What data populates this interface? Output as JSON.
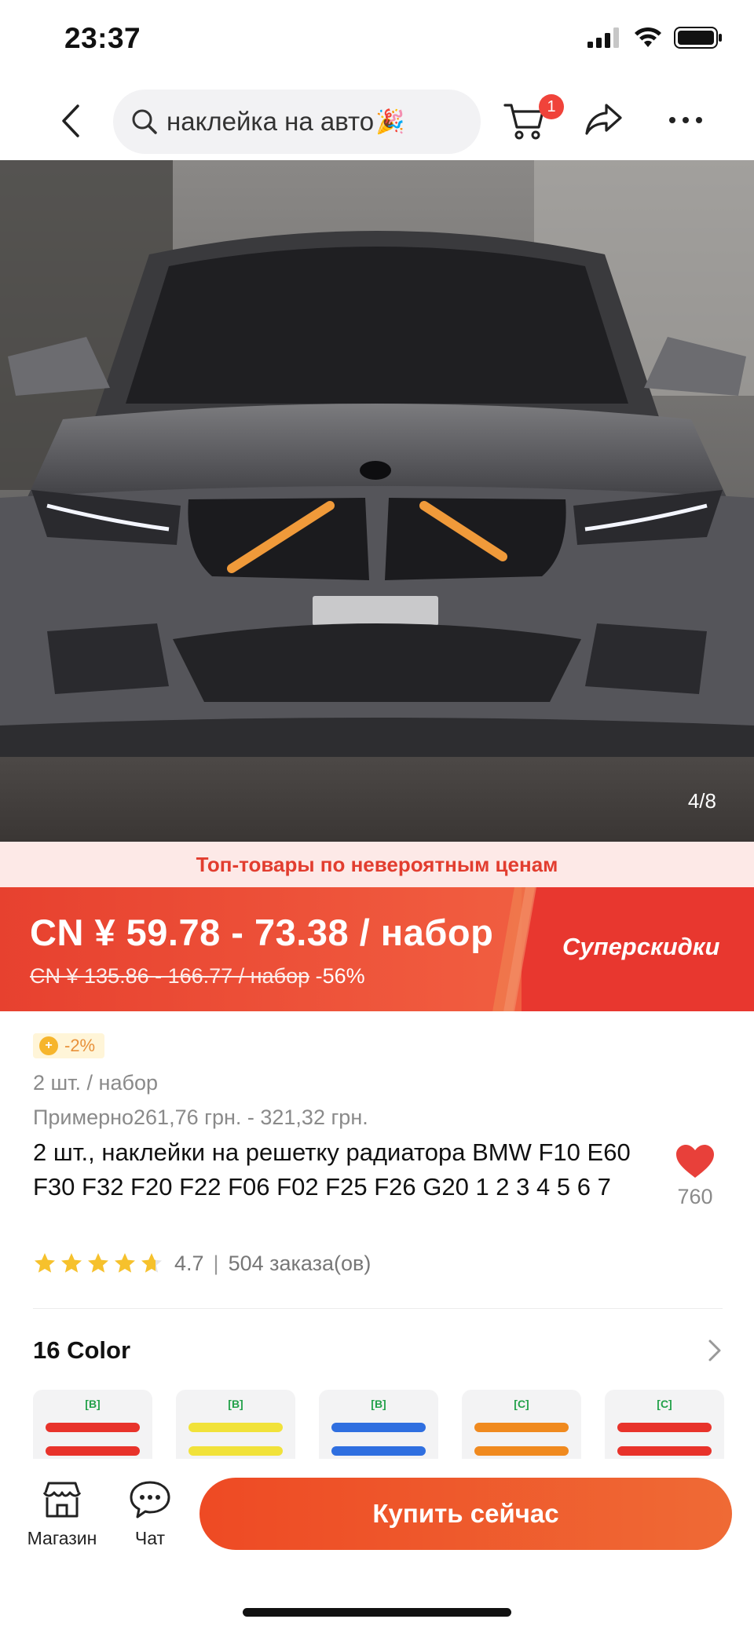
{
  "status_bar": {
    "time": "23:37"
  },
  "header": {
    "search_text": "наклейка на авто",
    "cart_badge": "1"
  },
  "product_image": {
    "counter": "4/8"
  },
  "promo": {
    "strip_text": "Топ-товары по невероятным ценам"
  },
  "price": {
    "current": "CN ¥  59.78 - 73.38 / набор",
    "old": "CN ¥  135.86 - 166.77 / набор",
    "discount": "-56%",
    "super_label": "Суперскидки"
  },
  "info": {
    "coupon": "-2%",
    "unit": "2 шт. / набор",
    "approx": "Примерно261,76 грн. - 321,32 грн.",
    "title": "2 шт., наклейки на решетку радиатора BMW F10 E60 F30 F32 F20 F22 F06 F02 F25 F26 G20 1 2 3 4 5 6 7",
    "wish_count": "760",
    "rating": "4.7",
    "rating_value": 4.7,
    "orders": "504 заказа(ов)"
  },
  "variants": {
    "title": "16 Color",
    "items": [
      {
        "label": "[B]",
        "color": "#e8332b"
      },
      {
        "label": "[B]",
        "color": "#f1e23a"
      },
      {
        "label": "[B]",
        "color": "#2f6fe0"
      },
      {
        "label": "[C]",
        "color": "#f08a1f"
      },
      {
        "label": "[C]",
        "color": "#e8332b"
      }
    ]
  },
  "bottom_bar": {
    "store_label": "Магазин",
    "chat_label": "Чат",
    "buy_label": "Купить сейчас"
  },
  "colors": {
    "accent": "#f0433a",
    "buy_button": "#ee5a2a",
    "star": "#f6c12c",
    "wish_heart": "#e8403a"
  }
}
